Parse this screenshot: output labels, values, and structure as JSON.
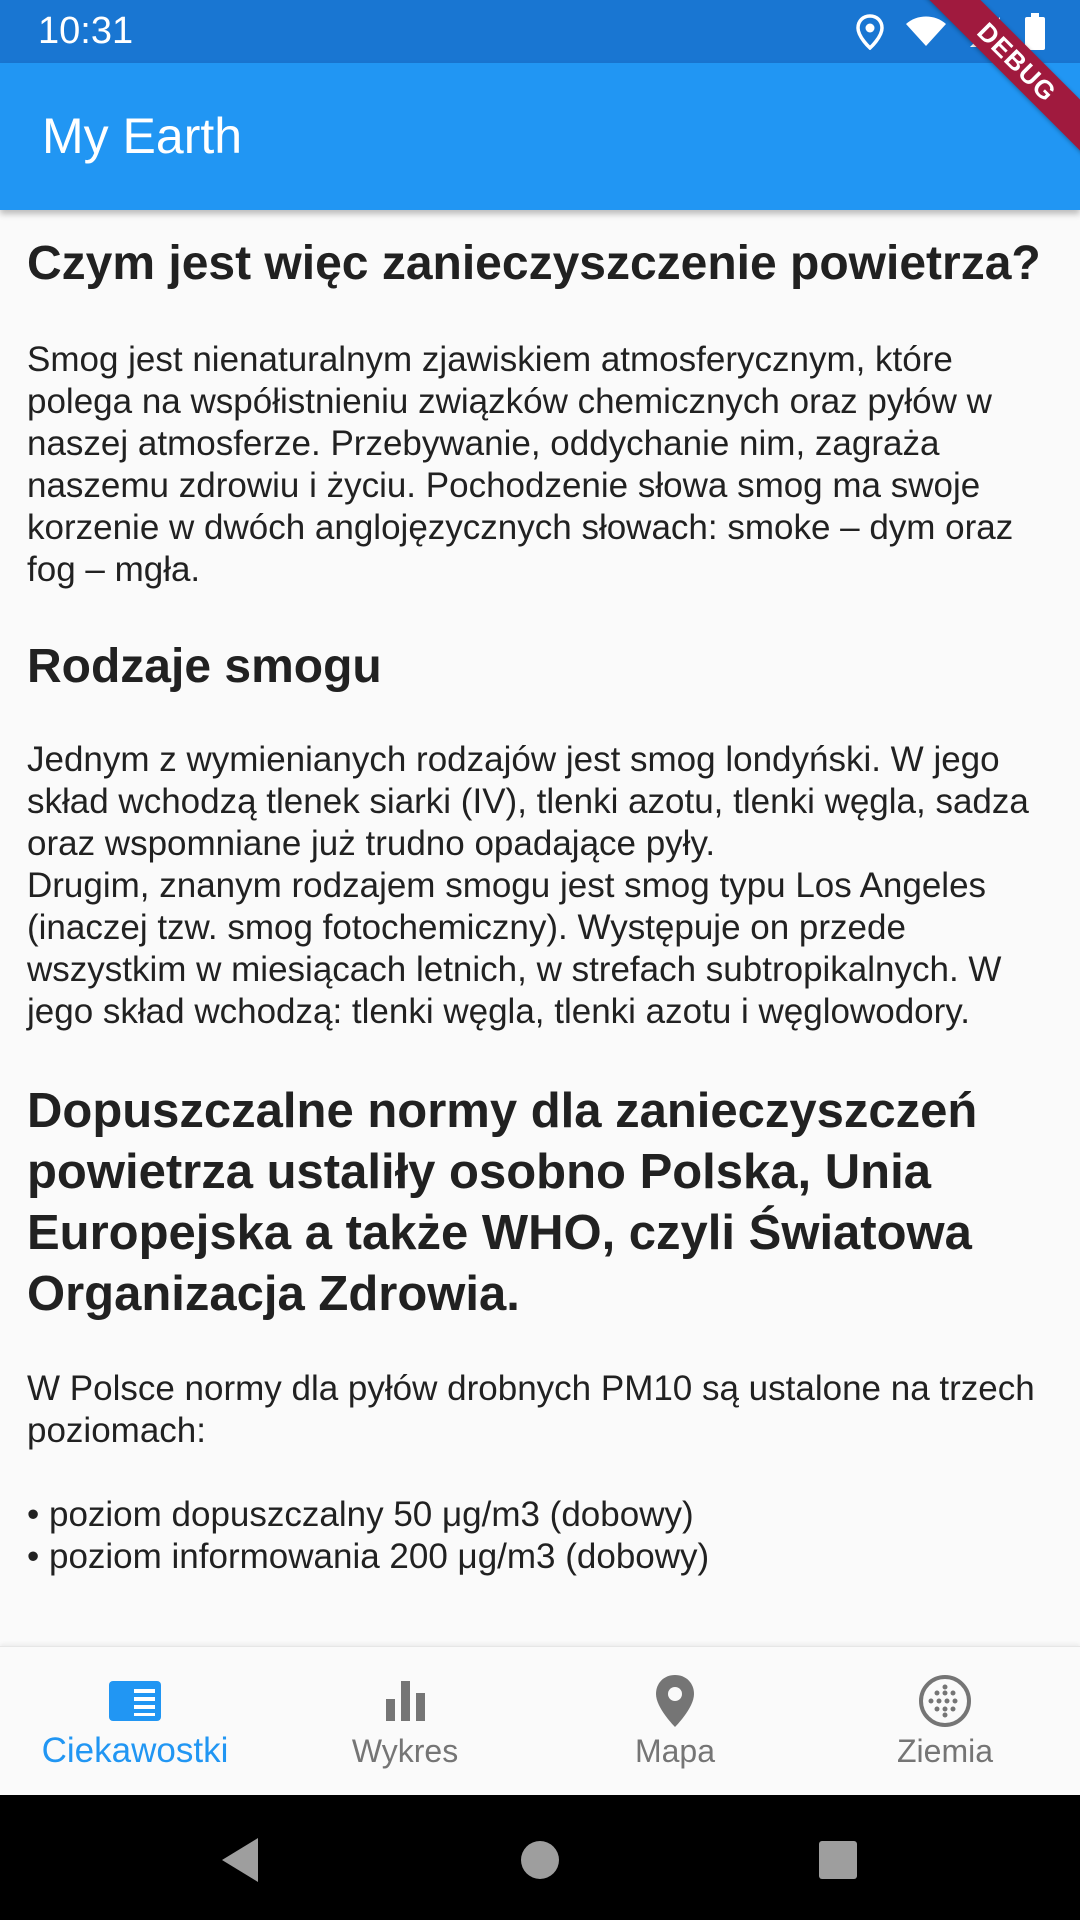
{
  "status_bar": {
    "time": "10:31",
    "icons": [
      "location-icon",
      "wifi-icon",
      "signal-icon",
      "battery-icon"
    ]
  },
  "debug_banner": "DEBUG",
  "app_bar": {
    "title": "My Earth"
  },
  "article": {
    "heading1": "Czym jest więc zanieczyszczenie powietrza?",
    "paragraph1": "Smog jest nienaturalnym zjawiskiem atmosferycznym, które polega na współistnieniu związków chemicznych oraz pyłów w naszej atmosferze. Przebywanie, oddychanie nim, zagraża naszemu zdrowiu i życiu. Pochodzenie słowa smog ma swoje korzenie w dwóch anglojęzycznych słowach: smoke – dym oraz fog – mgła.",
    "heading2": "Rodzaje smogu",
    "paragraph2a": "Jednym z wymienianych rodzajów jest smog londyński. W jego skład wchodzą tlenek siarki (IV), tlenki azotu, tlenki węgla, sadza oraz wspomniane już trudno opadające pyły.",
    "paragraph2b": "Drugim, znanym rodzajem smogu jest smog typu Los Angeles (inaczej tzw. smog fotochemiczny). Występuje on przede wszystkim w miesiącach letnich, w strefach subtropikalnych. W jego skład wchodzą: tlenki węgla, tlenki azotu i węglowodory.",
    "heading3": "Dopuszczalne normy dla zanieczyszczeń powietrza ustaliły osobno Polska, Unia Europejska a także WHO, czyli Światowa Organizacja Zdrowia.",
    "paragraph3": "W Polsce normy dla pyłów drobnych PM10 są ustalone na trzech poziomach:",
    "bullets": [
      "• poziom dopuszczalny 50 μg/m3 (dobowy)",
      "• poziom informowania 200 μg/m3 (dobowy)"
    ]
  },
  "bottom_nav": {
    "items": [
      {
        "label": "Ciekawostki",
        "icon": "article-icon",
        "active": true
      },
      {
        "label": "Wykres",
        "icon": "bar-chart-icon",
        "active": false
      },
      {
        "label": "Mapa",
        "icon": "map-pin-icon",
        "active": false
      },
      {
        "label": "Ziemia",
        "icon": "globe-icon",
        "active": false
      }
    ]
  },
  "colors": {
    "status_bar": "#1976d2",
    "app_bar": "#2196f3",
    "active_nav": "#2196f3",
    "inactive_nav": "#757575",
    "debug_banner": "#a01a3e"
  }
}
